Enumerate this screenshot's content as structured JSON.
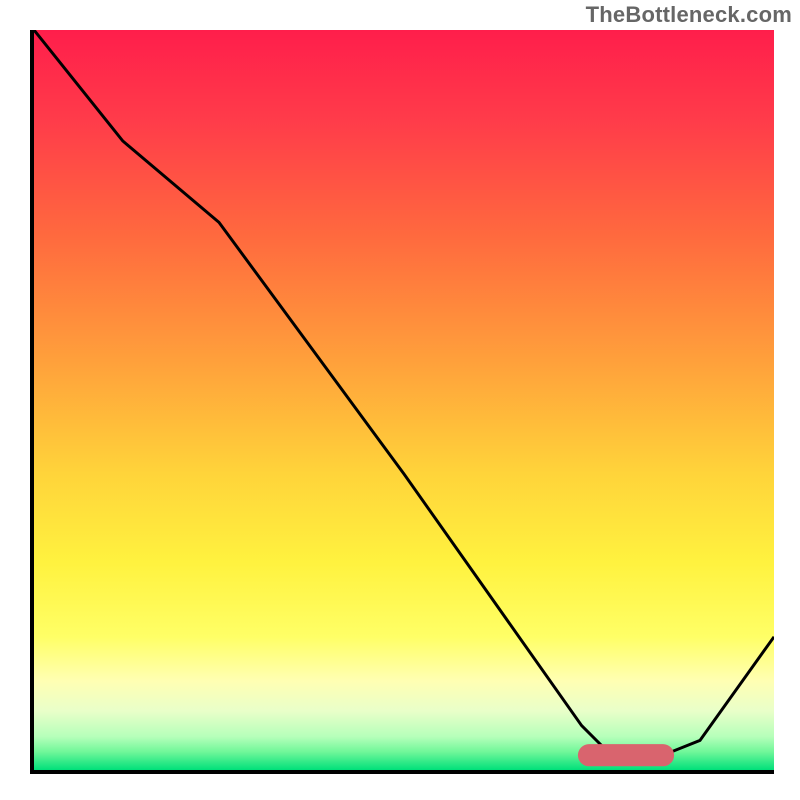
{
  "watermark": {
    "text": "TheBottleneck.com"
  },
  "colors": {
    "stroke": "#000000",
    "marker": "#d9646e",
    "gradient_stops": [
      {
        "pos": 0.0,
        "color": "#ff1e4b"
      },
      {
        "pos": 0.12,
        "color": "#ff3b4a"
      },
      {
        "pos": 0.28,
        "color": "#ff6a3e"
      },
      {
        "pos": 0.45,
        "color": "#ffa13b"
      },
      {
        "pos": 0.6,
        "color": "#ffd43a"
      },
      {
        "pos": 0.72,
        "color": "#fff23f"
      },
      {
        "pos": 0.82,
        "color": "#ffff66"
      },
      {
        "pos": 0.88,
        "color": "#ffffb3"
      },
      {
        "pos": 0.92,
        "color": "#e9ffc9"
      },
      {
        "pos": 0.955,
        "color": "#b6ffba"
      },
      {
        "pos": 0.975,
        "color": "#72f79a"
      },
      {
        "pos": 1.0,
        "color": "#00e07a"
      }
    ]
  },
  "chart_data": {
    "type": "line",
    "title": "",
    "xlabel": "",
    "ylabel": "",
    "xlim": [
      0,
      100
    ],
    "ylim": [
      0,
      100
    ],
    "grid": false,
    "series": [
      {
        "name": "bottleneck-curve",
        "x": [
          0,
          12,
          25,
          50,
          74,
          78,
          85,
          90,
          100
        ],
        "y": [
          100,
          85,
          74,
          40,
          6,
          2,
          2,
          4,
          18
        ]
      }
    ],
    "marker": {
      "name": "optimal-range",
      "x_start": 75,
      "x_end": 85,
      "y": 2,
      "thickness": 3
    }
  }
}
